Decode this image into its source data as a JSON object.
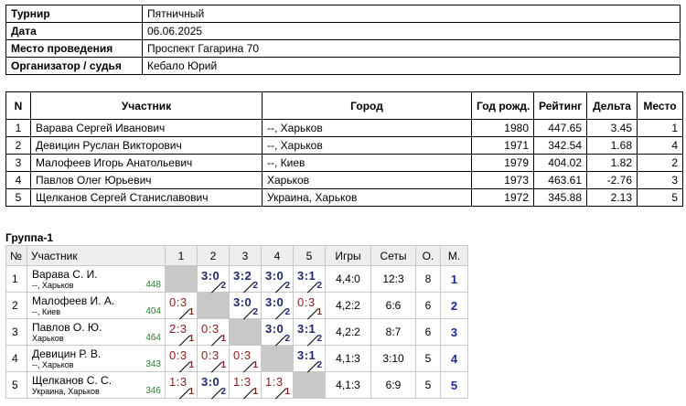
{
  "info": {
    "tournament_label": "Турнир",
    "tournament_value": "Пятничный",
    "date_label": "Дата",
    "date_value": "06.06.2025",
    "venue_label": "Место проведения",
    "venue_value": "Проспект Гагарина 70",
    "organizer_label": "Организатор / судья",
    "organizer_value": "Кебало Юрий"
  },
  "participants": {
    "headers": {
      "n": "N",
      "name": "Участник",
      "city": "Город",
      "year": "Год рожд.",
      "rating": "Рейтинг",
      "delta": "Дельта",
      "place": "Место"
    },
    "rows": [
      {
        "n": "1",
        "name": "Варава Сергей Иванович",
        "city": "--, Харьков",
        "year": "1980",
        "rating": "447.65",
        "delta": "3.45",
        "place": "1"
      },
      {
        "n": "2",
        "name": "Девицин Руслан Викторович",
        "city": "--, Харьков",
        "year": "1971",
        "rating": "342.54",
        "delta": "1.68",
        "place": "4"
      },
      {
        "n": "3",
        "name": "Малофеев Игорь Анатольевич",
        "city": "--, Киев",
        "year": "1979",
        "rating": "404.02",
        "delta": "1.82",
        "place": "2"
      },
      {
        "n": "4",
        "name": "Павлов Олег Юрьевич",
        "city": "Харьков",
        "year": "1973",
        "rating": "463.61",
        "delta": "-2.76",
        "place": "3"
      },
      {
        "n": "5",
        "name": "Щелканов Сергей Станиславович",
        "city": "Украина, Харьков",
        "year": "1972",
        "rating": "345.88",
        "delta": "2.13",
        "place": "5"
      }
    ]
  },
  "group": {
    "title": "Группа-1",
    "headers": {
      "n": "№",
      "player": "Участник",
      "c1": "1",
      "c2": "2",
      "c3": "3",
      "c4": "4",
      "c5": "5",
      "games": "Игры",
      "sets": "Сеты",
      "points": "О.",
      "place": "М."
    },
    "rows": [
      {
        "n": "1",
        "name": "Варава С. И.",
        "city": "--, Харьков",
        "rating": "448",
        "c2": {
          "score": "3:0",
          "pts": "2"
        },
        "c3": {
          "score": "3:2",
          "pts": "2"
        },
        "c4": {
          "score": "3:0",
          "pts": "2"
        },
        "c5": {
          "score": "3:1",
          "pts": "2"
        },
        "games": "4,4:0",
        "sets": "12:3",
        "points": "8",
        "place": "1"
      },
      {
        "n": "2",
        "name": "Малофеев И. А.",
        "city": "--, Киев",
        "rating": "404",
        "c1": {
          "score": "0:3",
          "pts": "1"
        },
        "c3": {
          "score": "3:0",
          "pts": "2"
        },
        "c4": {
          "score": "3:0",
          "pts": "2"
        },
        "c5": {
          "score": "0:3",
          "pts": "1"
        },
        "games": "4,2:2",
        "sets": "6:6",
        "points": "6",
        "place": "2"
      },
      {
        "n": "3",
        "name": "Павлов О. Ю.",
        "city": "Харьков",
        "rating": "464",
        "c1": {
          "score": "2:3",
          "pts": "1"
        },
        "c2": {
          "score": "0:3",
          "pts": "1"
        },
        "c4": {
          "score": "3:0",
          "pts": "2"
        },
        "c5": {
          "score": "3:1",
          "pts": "2"
        },
        "games": "4,2:2",
        "sets": "8:7",
        "points": "6",
        "place": "3"
      },
      {
        "n": "4",
        "name": "Девицин Р. В.",
        "city": "--, Харьков",
        "rating": "343",
        "c1": {
          "score": "0:3",
          "pts": "1"
        },
        "c2": {
          "score": "0:3",
          "pts": "1"
        },
        "c3": {
          "score": "0:3",
          "pts": "1"
        },
        "c5": {
          "score": "3:1",
          "pts": "2"
        },
        "games": "4,1:3",
        "sets": "3:10",
        "points": "5",
        "place": "4"
      },
      {
        "n": "5",
        "name": "Щелканов С. С.",
        "city": "Украина, Харьков",
        "rating": "346",
        "c1": {
          "score": "1:3",
          "pts": "1"
        },
        "c2": {
          "score": "3:0",
          "pts": "2"
        },
        "c3": {
          "score": "1:3",
          "pts": "1"
        },
        "c4": {
          "score": "1:3",
          "pts": "1"
        },
        "games": "4,1:3",
        "sets": "6:9",
        "points": "5",
        "place": "5"
      }
    ]
  },
  "colors": {
    "win": "#1f2a6e",
    "loss": "#8a1f1f",
    "rating": "#2f7d2f",
    "place": "#1f2a9e",
    "header_bg": "#eeeeee",
    "diagonal": "#c8c8c8"
  }
}
